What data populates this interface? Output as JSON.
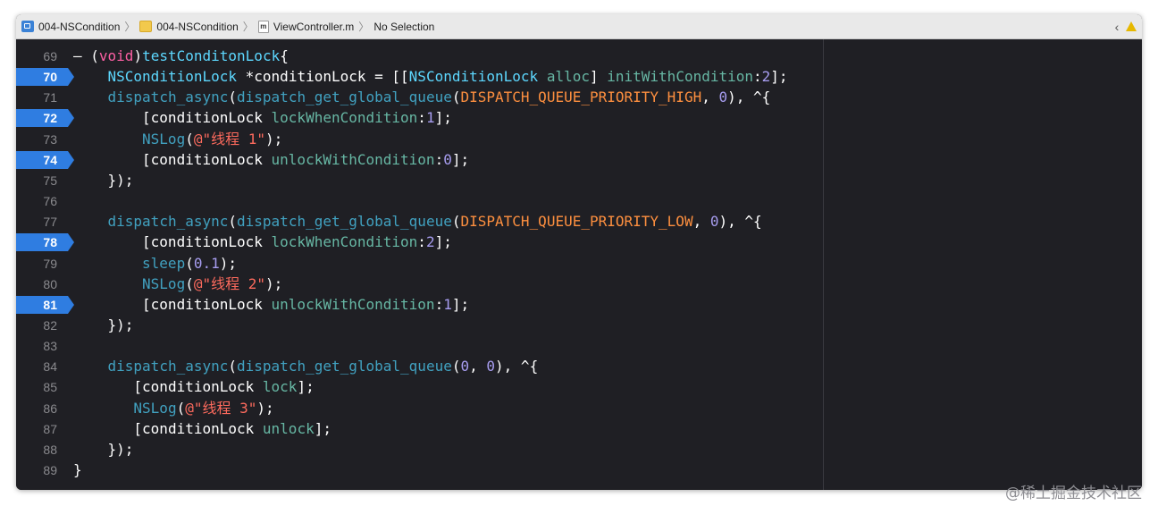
{
  "jumpbar": {
    "crumbs": [
      {
        "label": "004-NSCondition",
        "icon": "project-icon"
      },
      {
        "label": "004-NSCondition",
        "icon": "folder-icon"
      },
      {
        "label": "ViewController.m",
        "icon": "m-file-icon"
      },
      {
        "label": "No Selection",
        "icon": ""
      }
    ],
    "m_badge": "m"
  },
  "editor": {
    "lines": [
      {
        "n": "69",
        "bp": false,
        "ind": 0,
        "tokens": [
          [
            "– (",
            "plain"
          ],
          [
            "void",
            "kw"
          ],
          [
            ")",
            "plain"
          ],
          [
            "testConditonLock",
            "decl"
          ],
          [
            "{",
            "plain"
          ]
        ]
      },
      {
        "n": "70",
        "bp": true,
        "ind": 4,
        "tokens": [
          [
            "NSConditionLock",
            "type"
          ],
          [
            " *conditionLock = [[",
            "plain"
          ],
          [
            "NSConditionLock",
            "type"
          ],
          [
            " ",
            "plain"
          ],
          [
            "alloc",
            "method"
          ],
          [
            "] ",
            "plain"
          ],
          [
            "initWithCondition",
            "method"
          ],
          [
            ":",
            "plain"
          ],
          [
            "2",
            "num"
          ],
          [
            "];",
            "plain"
          ]
        ]
      },
      {
        "n": "71",
        "bp": false,
        "ind": 4,
        "tokens": [
          [
            "dispatch_async",
            "func"
          ],
          [
            "(",
            "plain"
          ],
          [
            "dispatch_get_global_queue",
            "func"
          ],
          [
            "(",
            "plain"
          ],
          [
            "DISPATCH_QUEUE_PRIORITY_HIGH",
            "macro"
          ],
          [
            ", ",
            "plain"
          ],
          [
            "0",
            "num"
          ],
          [
            "), ^{",
            "plain"
          ]
        ]
      },
      {
        "n": "72",
        "bp": true,
        "ind": 8,
        "tokens": [
          [
            "[conditionLock ",
            "plain"
          ],
          [
            "lockWhenCondition",
            "method"
          ],
          [
            ":",
            "plain"
          ],
          [
            "1",
            "num"
          ],
          [
            "];",
            "plain"
          ]
        ]
      },
      {
        "n": "73",
        "bp": false,
        "ind": 8,
        "tokens": [
          [
            "NSLog",
            "func"
          ],
          [
            "(",
            "plain"
          ],
          [
            "@\"线程 1\"",
            "str"
          ],
          [
            ");",
            "plain"
          ]
        ]
      },
      {
        "n": "74",
        "bp": true,
        "ind": 8,
        "tokens": [
          [
            "[conditionLock ",
            "plain"
          ],
          [
            "unlockWithCondition",
            "method"
          ],
          [
            ":",
            "plain"
          ],
          [
            "0",
            "num"
          ],
          [
            "];",
            "plain"
          ]
        ]
      },
      {
        "n": "75",
        "bp": false,
        "ind": 4,
        "tokens": [
          [
            "});",
            "plain"
          ]
        ]
      },
      {
        "n": "76",
        "bp": false,
        "ind": 0,
        "tokens": []
      },
      {
        "n": "77",
        "bp": false,
        "ind": 4,
        "tokens": [
          [
            "dispatch_async",
            "func"
          ],
          [
            "(",
            "plain"
          ],
          [
            "dispatch_get_global_queue",
            "func"
          ],
          [
            "(",
            "plain"
          ],
          [
            "DISPATCH_QUEUE_PRIORITY_LOW",
            "macro"
          ],
          [
            ", ",
            "plain"
          ],
          [
            "0",
            "num"
          ],
          [
            "), ^{",
            "plain"
          ]
        ]
      },
      {
        "n": "78",
        "bp": true,
        "ind": 8,
        "tokens": [
          [
            "[conditionLock ",
            "plain"
          ],
          [
            "lockWhenCondition",
            "method"
          ],
          [
            ":",
            "plain"
          ],
          [
            "2",
            "num"
          ],
          [
            "];",
            "plain"
          ]
        ]
      },
      {
        "n": "79",
        "bp": false,
        "ind": 8,
        "tokens": [
          [
            "sleep",
            "func"
          ],
          [
            "(",
            "plain"
          ],
          [
            "0.1",
            "num"
          ],
          [
            ");",
            "plain"
          ]
        ]
      },
      {
        "n": "80",
        "bp": false,
        "ind": 8,
        "tokens": [
          [
            "NSLog",
            "func"
          ],
          [
            "(",
            "plain"
          ],
          [
            "@\"线程 2\"",
            "str"
          ],
          [
            ");",
            "plain"
          ]
        ]
      },
      {
        "n": "81",
        "bp": true,
        "ind": 8,
        "tokens": [
          [
            "[conditionLock ",
            "plain"
          ],
          [
            "unlockWithCondition",
            "method"
          ],
          [
            ":",
            "plain"
          ],
          [
            "1",
            "num"
          ],
          [
            "];",
            "plain"
          ]
        ]
      },
      {
        "n": "82",
        "bp": false,
        "ind": 4,
        "tokens": [
          [
            "});",
            "plain"
          ]
        ]
      },
      {
        "n": "83",
        "bp": false,
        "ind": 0,
        "tokens": []
      },
      {
        "n": "84",
        "bp": false,
        "ind": 4,
        "tokens": [
          [
            "dispatch_async",
            "func"
          ],
          [
            "(",
            "plain"
          ],
          [
            "dispatch_get_global_queue",
            "func"
          ],
          [
            "(",
            "plain"
          ],
          [
            "0",
            "num"
          ],
          [
            ", ",
            "plain"
          ],
          [
            "0",
            "num"
          ],
          [
            "), ^{",
            "plain"
          ]
        ]
      },
      {
        "n": "85",
        "bp": false,
        "ind": 7,
        "tokens": [
          [
            "[conditionLock ",
            "plain"
          ],
          [
            "lock",
            "method"
          ],
          [
            "];",
            "plain"
          ]
        ]
      },
      {
        "n": "86",
        "bp": false,
        "ind": 7,
        "tokens": [
          [
            "NSLog",
            "func"
          ],
          [
            "(",
            "plain"
          ],
          [
            "@\"线程 3\"",
            "str"
          ],
          [
            ");",
            "plain"
          ]
        ]
      },
      {
        "n": "87",
        "bp": false,
        "ind": 7,
        "tokens": [
          [
            "[conditionLock ",
            "plain"
          ],
          [
            "unlock",
            "method"
          ],
          [
            "];",
            "plain"
          ]
        ]
      },
      {
        "n": "88",
        "bp": false,
        "ind": 4,
        "tokens": [
          [
            "});",
            "plain"
          ]
        ]
      },
      {
        "n": "89",
        "bp": false,
        "ind": 0,
        "tokens": [
          [
            "}",
            "plain"
          ]
        ]
      }
    ]
  },
  "watermark": "@稀土掘金技术社区",
  "colors": {
    "editor_bg": "#1f1f24",
    "breakpoint": "#2f7de1",
    "keyword": "#fc5fa3",
    "declaration": "#5dd8ff",
    "method": "#67b7a4",
    "function": "#41a1c0",
    "number": "#a79df0",
    "macro": "#fd8f3f",
    "string": "#fc6a5d"
  }
}
